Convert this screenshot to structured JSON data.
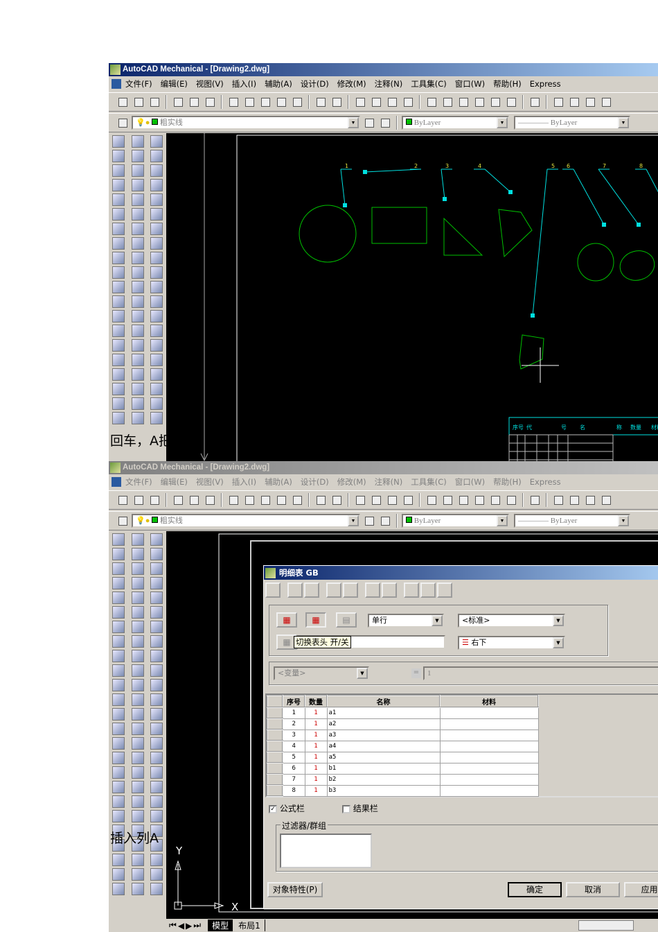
{
  "window": {
    "title": "AutoCAD Mechanical - [Drawing2.dwg]"
  },
  "menu": [
    "文件(F)",
    "编辑(E)",
    "视图(V)",
    "插入(I)",
    "辅助(A)",
    "设计(D)",
    "修改(M)",
    "注释(N)",
    "工具集(C)",
    "窗口(W)",
    "帮助(H)",
    "Express"
  ],
  "toolbar1_icons": [
    "new-icon",
    "open-icon",
    "save-icon",
    "print-icon",
    "preview-icon",
    "publish-icon",
    "cut-icon",
    "copy-icon",
    "paste-icon",
    "matchprop-icon",
    "brush-icon",
    "undo-icon",
    "redo-icon",
    "pan-icon",
    "zoom-realtime-icon",
    "zoom-window-icon",
    "zoom-previous-icon",
    "properties-icon",
    "designcenter-icon",
    "toolpalette-icon",
    "dbconnect-icon",
    "markup-icon",
    "calculator-icon",
    "help-icon",
    "zoom-icon",
    "pan2-icon",
    "zoom2-icon",
    "zoom3-icon"
  ],
  "layer": {
    "name": "粗实线",
    "color": "#00c000"
  },
  "properties": {
    "color": "ByLayer",
    "linetype": "ByLayer"
  },
  "drawing": {
    "balloons": [
      "1",
      "2",
      "3",
      "4",
      "5",
      "6",
      "7",
      "8"
    ],
    "annotation1": "回车，A把",
    "annotation2": "插入列A",
    "titleblock_headers": [
      "序号",
      "代",
      "号",
      "名",
      "称",
      "数量",
      "材料"
    ],
    "entity_color": "#00c000",
    "leader_color": "#00e0e0"
  },
  "ucs": {
    "x": "X",
    "y": "Y"
  },
  "layout_tabs": [
    "模型",
    "布局1"
  ],
  "dialog": {
    "title": "明细表 GB",
    "toolbar_icons": [
      "print-icon",
      "insert-row-above-icon",
      "insert-row-below-icon",
      "merge-icon",
      "split-icon",
      "sort-icon",
      "edit-icon",
      "table-icon",
      "save-table-icon",
      "shield-icon"
    ],
    "row_mode": "单行",
    "style": "<标准>",
    "tooltip": "切换表头 开/关",
    "position": "右下",
    "variable": "<变量>",
    "formula_value": "1",
    "table": {
      "headers": [
        "序号",
        "数量",
        "名称",
        "材料"
      ],
      "rows": [
        [
          "1",
          "1",
          "a1",
          ""
        ],
        [
          "2",
          "1",
          "a2",
          ""
        ],
        [
          "3",
          "1",
          "a3",
          ""
        ],
        [
          "4",
          "1",
          "a4",
          ""
        ],
        [
          "5",
          "1",
          "a5",
          ""
        ],
        [
          "6",
          "1",
          "b1",
          ""
        ],
        [
          "7",
          "1",
          "b2",
          ""
        ],
        [
          "8",
          "1",
          "b3",
          ""
        ]
      ]
    },
    "formula_bar": {
      "label": "公式栏",
      "checked": true
    },
    "result_bar": {
      "label": "结果栏",
      "checked": false
    },
    "filter_group": "过滤器/群组",
    "buttons": {
      "properties": "对象特性(P)",
      "ok": "确定",
      "cancel": "取消",
      "apply": "应用("
    }
  }
}
